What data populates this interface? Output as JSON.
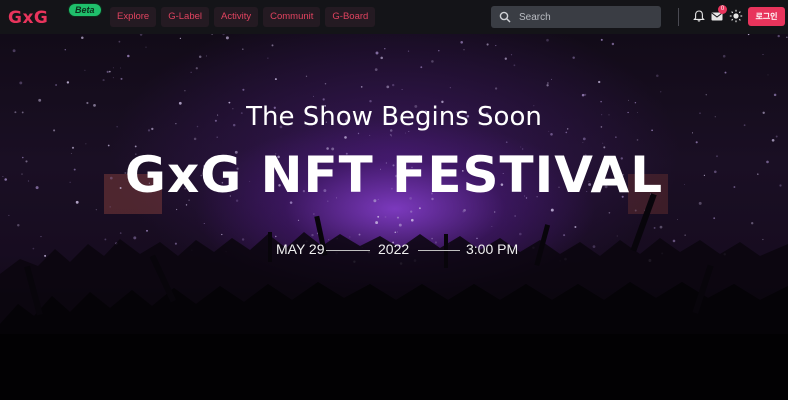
{
  "header": {
    "logo_text": "GxG",
    "beta_label": "Beta",
    "nav": [
      "Explore",
      "G-Label",
      "Activity",
      "Communit",
      "G-Board"
    ],
    "search_placeholder": "Search",
    "mail_count": "0",
    "login_label": "로그인"
  },
  "hero": {
    "subtitle": "The Show Begins Soon",
    "title": "GxG NFT FESTIVAL",
    "date": {
      "month_day": "MAY 29",
      "year": "2022",
      "time": "3:00 PM"
    }
  },
  "colors": {
    "brand": "#e8345c",
    "beta_badge": "#1fbf6b",
    "header_bg": "#141418",
    "hero_glow": "#9646e6"
  },
  "icons": [
    "search-icon",
    "bell-icon",
    "mail-icon",
    "sun-icon"
  ]
}
